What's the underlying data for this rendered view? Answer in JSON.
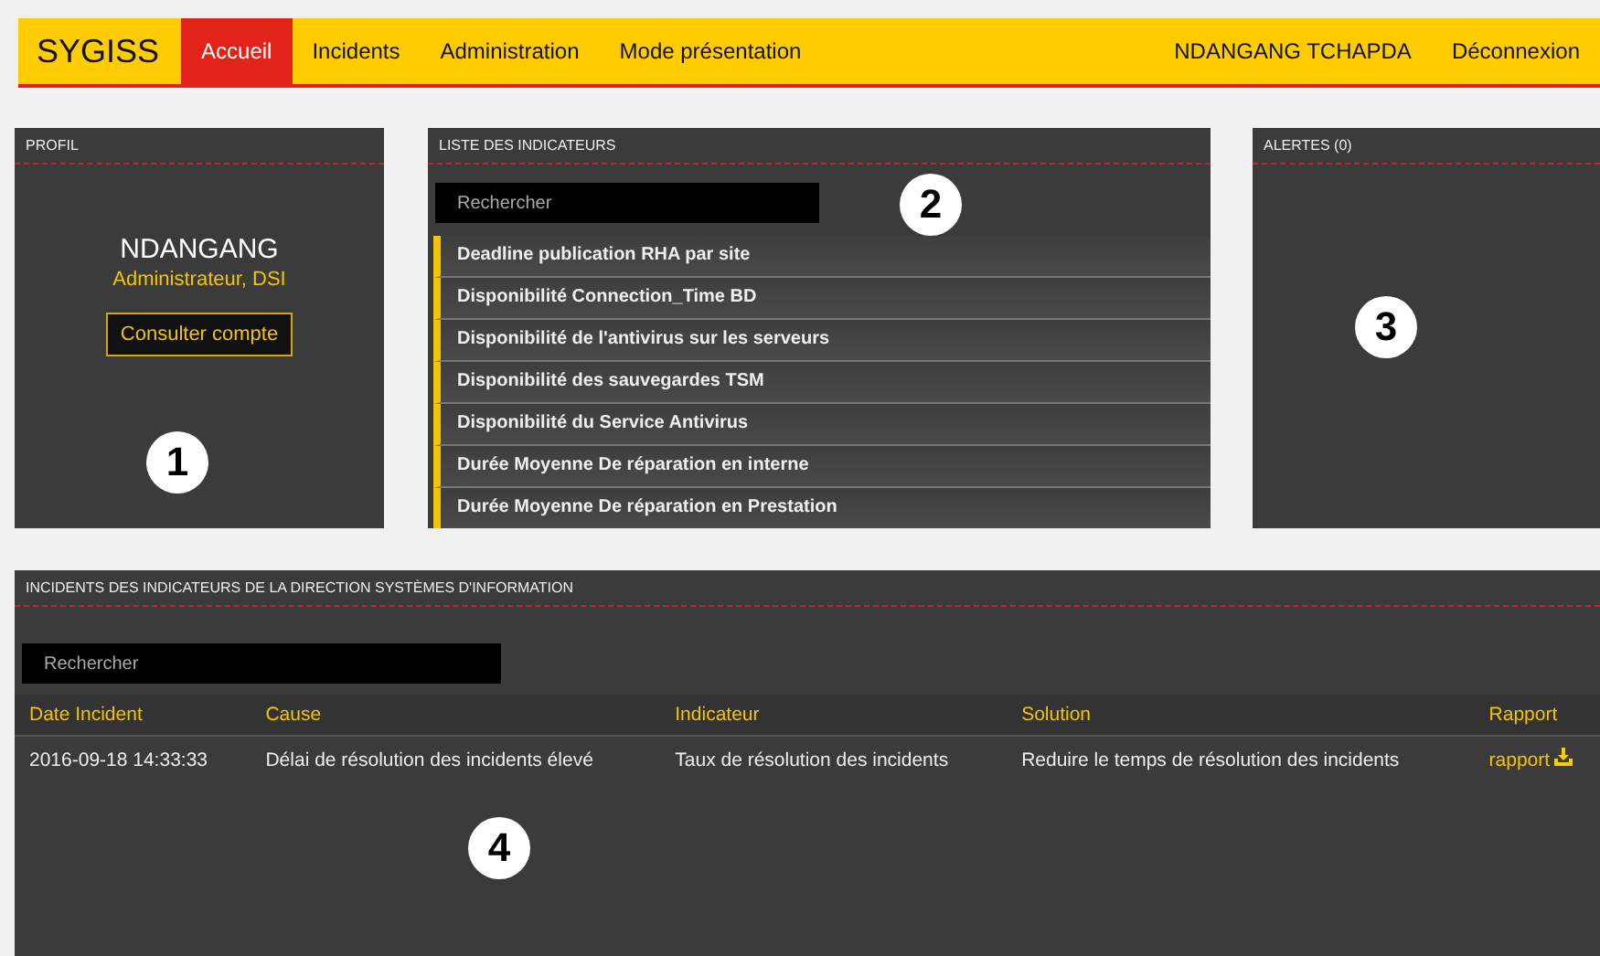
{
  "navbar": {
    "brand": "SYGISS",
    "items": [
      {
        "label": "Accueil",
        "selected": true
      },
      {
        "label": "Incidents",
        "selected": false
      },
      {
        "label": "Administration",
        "selected": false
      },
      {
        "label": "Mode présentation",
        "selected": false
      }
    ],
    "user": "NDANGANG TCHAPDA",
    "logout": "Déconnexion"
  },
  "profil": {
    "title": "PROFIL",
    "name": "NDANGANG",
    "role": "Administrateur, DSI",
    "button": "Consulter compte",
    "callout": "1"
  },
  "indicateurs": {
    "title": "LISTE DES INDICATEURS",
    "search": {
      "placeholder": "Rechercher"
    },
    "callout": "2",
    "items": [
      "Deadline publication RHA par site",
      "Disponibilité Connection_Time BD",
      "Disponibilité de l'antivirus sur les serveurs",
      "Disponibilité des sauvegardes TSM",
      "Disponibilité du Service Antivirus",
      "Durée Moyenne De réparation en interne",
      "Durée Moyenne De réparation en Prestation"
    ]
  },
  "alertes": {
    "title": "ALERTES (0)",
    "callout": "3"
  },
  "incidents": {
    "title": "INCIDENTS DES INDICATEURS DE LA DIRECTION SYSTÈMES D'INFORMATION",
    "search": {
      "placeholder": "Rechercher"
    },
    "callout": "4",
    "columns": [
      "Date Incident",
      "Cause",
      "Indicateur",
      "Solution",
      "Rapport"
    ],
    "rows": [
      {
        "cells": [
          "2016-09-18 14:33:33",
          "Délai de résolution des incidents élevé",
          "Taux de résolution des incidents",
          "Reduire le temps de résolution des incidents"
        ],
        "link": "rapport"
      }
    ]
  }
}
